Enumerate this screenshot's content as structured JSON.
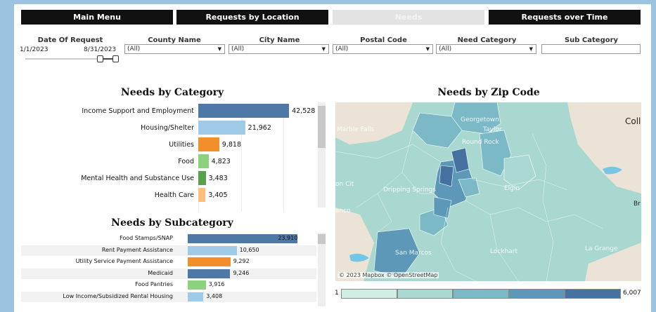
{
  "nav": {
    "main_menu": "Main Menu",
    "requests_by_location": "Requests by Location",
    "needs": "Needs",
    "requests_over_time": "Requests over Time"
  },
  "filters": {
    "date_label": "Date Of Request",
    "date_start": "1/1/2023",
    "date_end": "8/31/2023",
    "date_slider_start": 0.91,
    "date_slider_end": 1.0,
    "county_label": "County Name",
    "county_value": "(All)",
    "city_label": "City Name",
    "city_value": "(All)",
    "postal_label": "Postal Code",
    "postal_value": "(All)",
    "need_label": "Need Category",
    "need_value": "(All)",
    "sub_label": "Sub Category",
    "sub_value": ""
  },
  "category_chart": {
    "title": "Needs by Category"
  },
  "subcategory_chart": {
    "title": "Needs by Subcategory"
  },
  "map": {
    "title": "Needs by Zip Code",
    "attribution": "© 2023 Mapbox  © OpenStreetMap",
    "place_labels": [
      "Marble Falls",
      "Georgetown",
      "Taylor",
      "Round Rock",
      "Elgin",
      "Dripping Springs",
      "San Marcos",
      "Lockhart",
      "La Grange",
      "Coll",
      "Br",
      "on Cit",
      "anco"
    ],
    "legend_min": "1",
    "legend_max": "6,007",
    "legend_colors": [
      "#cfeee6",
      "#aad8d2",
      "#7bb9c6",
      "#5e98b8",
      "#44719f"
    ]
  },
  "chart_data": [
    {
      "type": "bar",
      "title": "Needs by Category",
      "categories": [
        "Income Support and Employment",
        "Housing/Shelter",
        "Utilities",
        "Food",
        "Mental Health and Substance Use",
        "Health Care"
      ],
      "values": [
        42528,
        21962,
        9818,
        4823,
        3483,
        3405
      ],
      "value_labels": [
        "42,528",
        "21,962",
        "9,818",
        "4,823",
        "3,483",
        "3,405"
      ],
      "colors": [
        "#4e79a7",
        "#a0cbe8",
        "#f28e2b",
        "#8cd17d",
        "#59a14f",
        "#ffbe7d"
      ],
      "xlim": [
        0,
        56000
      ]
    },
    {
      "type": "bar",
      "title": "Needs by Subcategory",
      "categories": [
        "Food Stamps/SNAP",
        "Rent Payment Assistance",
        "Utility Service Payment Assistance",
        "Medicaid",
        "Food Pantries",
        "Low Income/Subsidized Rental Housing"
      ],
      "values": [
        23910,
        10650,
        9292,
        9246,
        3916,
        3408
      ],
      "value_labels": [
        "23,910",
        "10,650",
        "9,292",
        "9,246",
        "3,916",
        "3,408"
      ],
      "colors": [
        "#4e79a7",
        "#a0cbe8",
        "#f28e2b",
        "#4e79a7",
        "#8cd17d",
        "#a0cbe8"
      ],
      "xlim": [
        0,
        26000
      ]
    }
  ]
}
